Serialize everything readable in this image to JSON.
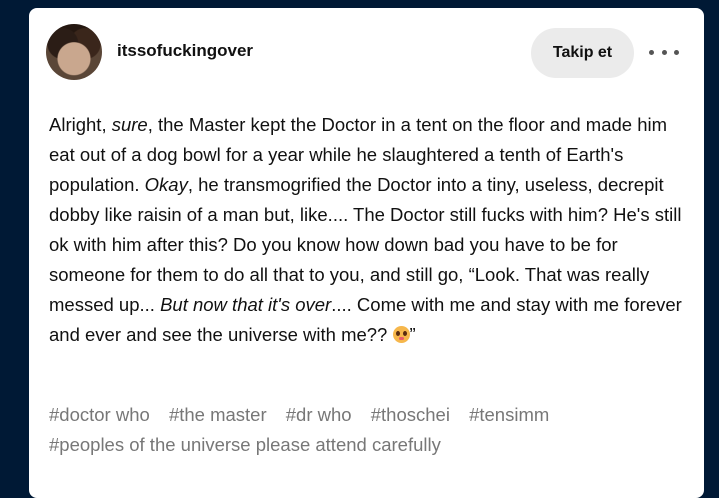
{
  "post": {
    "username": "itssofuckingover",
    "follow_label": "Takip et",
    "more_icon": "ellipsis-icon",
    "body": [
      "Alright, ",
      "sure",
      ", the Master kept the Doctor in a tent on the floor and made him eat out of a dog bowl for a year while he slaughtered a tenth of Earth's population. ",
      "Okay",
      ", he transmogrified the Doctor into a tiny, useless, decrepit dobby like raisin of a man but, like.... The Doctor still fucks with him? He's still ok with him after this? Do you know how down bad you have to be for someone for them to do all that to you, and still go, “Look. That was really messed up... ",
      "But now that it's over",
      ".... Come with me and stay with me forever and ever and see the universe with me?? ",
      "”"
    ],
    "emoji": "pleading-face-icon",
    "tags": [
      "#doctor who",
      "#the master",
      "#dr who",
      "#thoschei",
      "#tensimm",
      "#peoples of the universe please attend carefully"
    ]
  },
  "colors": {
    "background": "#001935",
    "card": "#ffffff",
    "text": "#111111",
    "tag_text": "#777777",
    "follow_button_bg": "#ebebeb"
  }
}
